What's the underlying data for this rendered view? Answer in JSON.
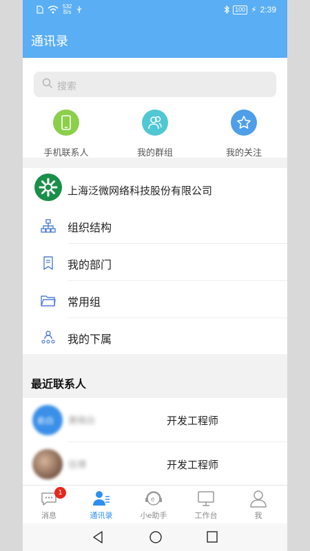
{
  "status_bar": {
    "net_speed": "532",
    "net_unit": "B/s",
    "battery": "100",
    "time": "2:39"
  },
  "header": {
    "title": "通讯录"
  },
  "search": {
    "placeholder": "搜索"
  },
  "quick_links": [
    {
      "label": "手机联系人",
      "icon": "phone-icon",
      "color": "#8bcf4a"
    },
    {
      "label": "我的群组",
      "icon": "group-icon",
      "color": "#4fc8d3"
    },
    {
      "label": "我的关注",
      "icon": "star-icon",
      "color": "#4e9ee8"
    }
  ],
  "org": {
    "company": "上海泛微网络科技股份有限公司",
    "items": [
      {
        "label": "组织结构",
        "icon": "org-chart-icon"
      },
      {
        "label": "我的部门",
        "icon": "bookmark-icon"
      },
      {
        "label": "常用组",
        "icon": "folder-icon"
      },
      {
        "label": "我的下属",
        "icon": "subordinates-icon"
      }
    ]
  },
  "recent": {
    "title": "最近联系人",
    "contacts": [
      {
        "avatar_text": "俞白",
        "name": "黄晓白",
        "role": "开发工程师"
      },
      {
        "name": "伍博",
        "role": "开发工程师"
      }
    ]
  },
  "tabs": [
    {
      "label": "消息",
      "icon": "message-icon",
      "badge": "1",
      "active": false
    },
    {
      "label": "通讯录",
      "icon": "contacts-icon",
      "active": true
    },
    {
      "label": "小e助手",
      "icon": "assistant-icon",
      "active": false
    },
    {
      "label": "工作台",
      "icon": "desktop-icon",
      "active": false
    },
    {
      "label": "我",
      "icon": "person-icon",
      "active": false
    }
  ],
  "colors": {
    "primary": "#5aaef3",
    "active_tab": "#2e8ff0",
    "badge": "#e8271c"
  }
}
